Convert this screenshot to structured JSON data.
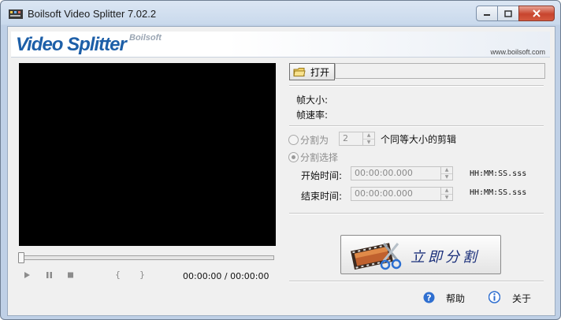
{
  "window": {
    "title": "Boilsoft Video Splitter 7.02.2",
    "controls": [
      "minimize",
      "maximize",
      "close"
    ]
  },
  "banner": {
    "logo": "Video Splitter",
    "logo_sub": "Boilsoft",
    "website": "www.boilsoft.com"
  },
  "player": {
    "play_icon": "play-icon",
    "pause_icon": "pause-icon",
    "stop_icon": "stop-icon",
    "mark_in": "{",
    "mark_out": "}",
    "position": "00:00:00 / 00:00:00"
  },
  "file": {
    "open_label": "打开",
    "path": ""
  },
  "info": {
    "frame_size_label": "帧大小:",
    "frame_rate_label": "帧速率:"
  },
  "options": {
    "split_into_label": "分割为",
    "split_count": "2",
    "split_into_suffix": "个同等大小的剪辑",
    "split_select_label": "分割选择",
    "start_time_label": "开始时间:",
    "start_time": "00:00:00.000",
    "end_time_label": "结束时间:",
    "end_time": "00:00:00.000",
    "time_format": "HH:MM:SS.sss"
  },
  "actions": {
    "split_now": "立即分割",
    "help": "帮助",
    "about": "关于"
  },
  "colors": {
    "title_bar": "#c9d9ec",
    "logo": "#1d5fa8",
    "split_label": "#1a2f7a",
    "video_bg": "#000000"
  }
}
